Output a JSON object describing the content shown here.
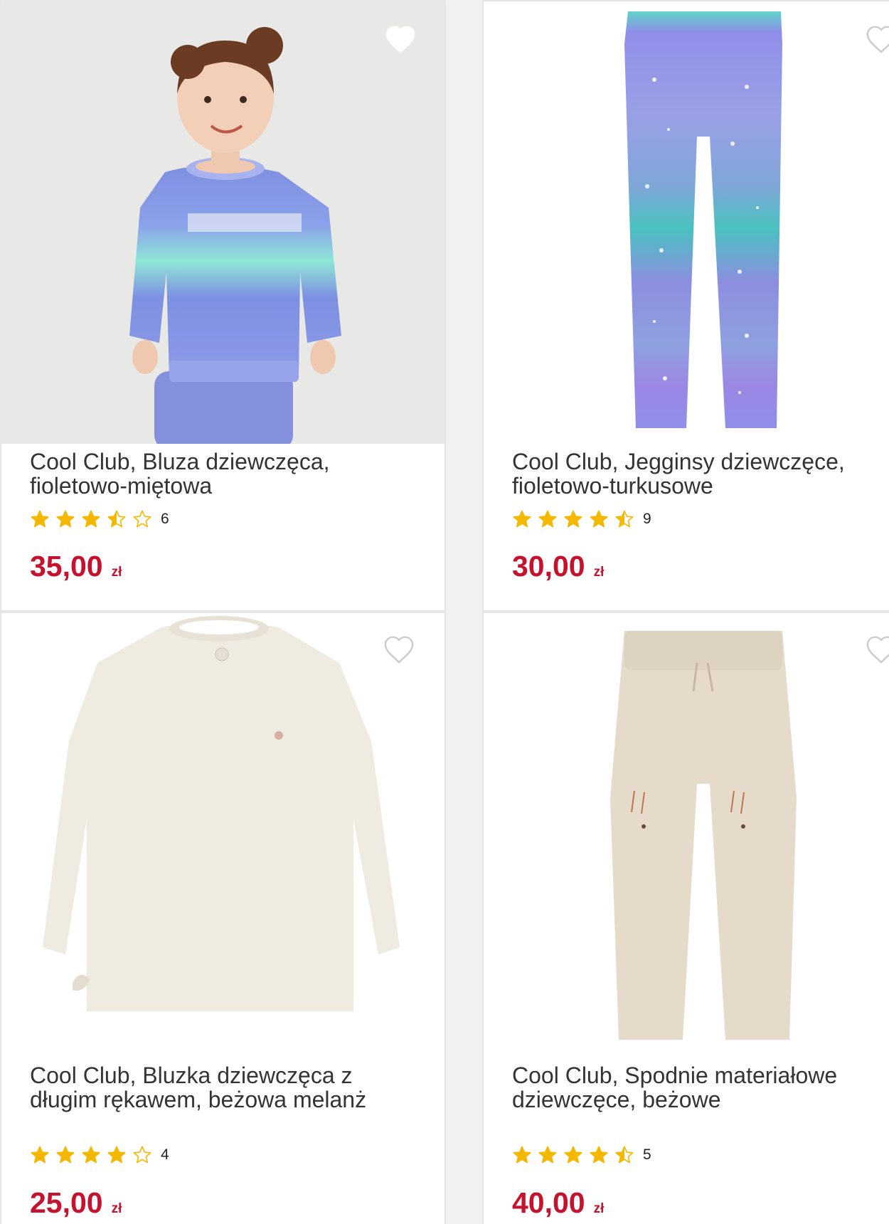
{
  "products": [
    {
      "title": "Cool Club, Bluza dziewczęca, fioletowo-miętowa",
      "rating": 3.5,
      "review_count": "6",
      "price": "35,00",
      "currency": "zł",
      "image": "girl-sweatshirt-photo"
    },
    {
      "title": "Cool Club, Jegginsy dziewczęce, fioletowo-turkusowe",
      "rating": 4.5,
      "review_count": "9",
      "price": "30,00",
      "currency": "zł",
      "image": "leggings-photo"
    },
    {
      "title": "Cool Club, Bluzka dziewczęca z długim rękawem, beżowa melanż",
      "rating": 4,
      "review_count": "4",
      "price": "25,00",
      "currency": "zł",
      "image": "blouse-photo"
    },
    {
      "title": "Cool Club, Spodnie materiałowe dziewczęce, beżowe",
      "rating": 4.5,
      "review_count": "5",
      "price": "40,00",
      "currency": "zł",
      "image": "trousers-photo"
    }
  ],
  "colors": {
    "price": "#c4122f",
    "star": "#f5b800",
    "card_bg": "#ffffff",
    "page_bg": "#f1f1f1"
  },
  "icons": {
    "wishlist": "heart-icon",
    "rating": "star-icon"
  }
}
